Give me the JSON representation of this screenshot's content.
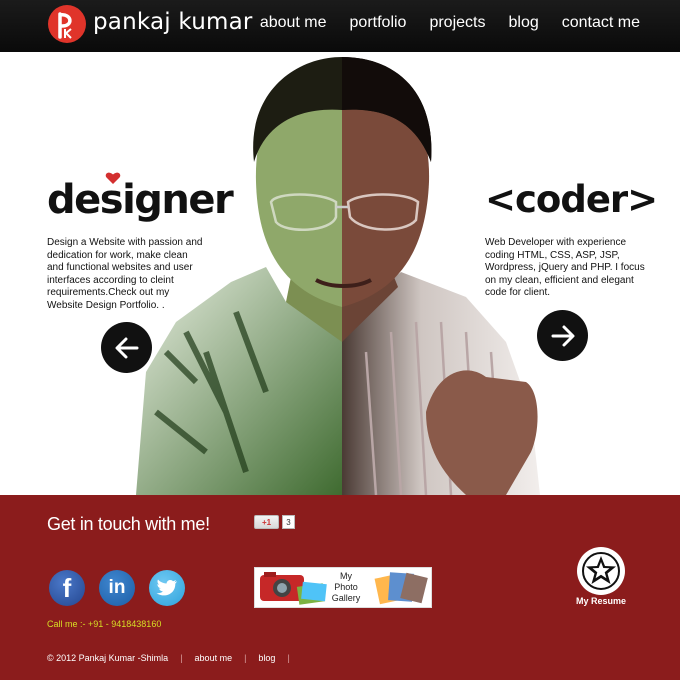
{
  "header": {
    "logo_text": "pankaj kumar",
    "nav": [
      "about me",
      "portfolio",
      "projects",
      "blog",
      "contact me"
    ]
  },
  "hero": {
    "designer_title": "designer",
    "designer_text": "Design a Website with passion and dedication for work, make clean and functional websites and user interfaces according to cleint requirements.Check out my Website Design Portfolio. .",
    "coder_title": "<coder>",
    "coder_text": "Web Developer with experience coding HTML, CSS, ASP, JSP, Wordpress, jQuery and PHP. I focus on my clean, efficient and elegant code for client."
  },
  "footer": {
    "touch_heading": "Get in touch with me!",
    "gplus_label": "+1",
    "gplus_count": "3",
    "gallery_label": "My Photo Gallery",
    "call": "Call me :- +91 - 9418438160",
    "resume_label": "My Resume",
    "copyright": "© 2012 Pankaj Kumar -Shimla",
    "links": [
      "about me",
      "blog"
    ]
  },
  "colors": {
    "header_bg": "#111111",
    "footer_bg": "#8b1c1c",
    "logo_red": "#e0342a",
    "call_text": "#d7df25"
  },
  "icons": [
    "logo-icon",
    "heart-icon",
    "arrow-left-icon",
    "arrow-right-icon",
    "facebook-icon",
    "linkedin-icon",
    "twitter-icon",
    "star-icon"
  ]
}
